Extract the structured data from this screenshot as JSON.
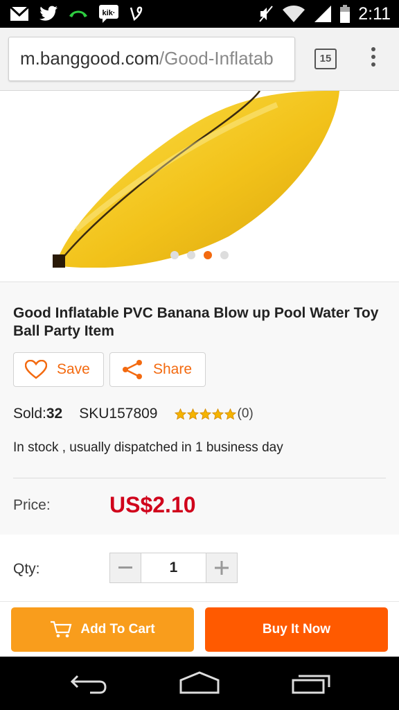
{
  "status_bar": {
    "time": "2:11",
    "left_icons": [
      "gmail-icon",
      "twitter-icon",
      "call-icon",
      "kik-icon",
      "vine-icon"
    ],
    "right_icons": [
      "mute-icon",
      "wifi-icon",
      "signal-icon",
      "battery-icon"
    ]
  },
  "browser": {
    "url_domain": "m.banggood.com",
    "url_path": "/Good-Inflatab",
    "tab_count": "15"
  },
  "product": {
    "title": "Good Inflatable PVC Banana Blow up Pool Water Toy Ball Party Item",
    "carousel": {
      "total": 4,
      "active_index": 2
    },
    "save_label": "Save",
    "share_label": "Share",
    "sold_label": "Sold:",
    "sold_count": "32",
    "sku": "SKU157809",
    "rating_stars": 5,
    "review_count": "(0)",
    "stock_text": "In stock , usually dispatched in 1 business day",
    "price_label": "Price:",
    "price_value": "US$2.10",
    "qty_label": "Qty:",
    "qty_value": "1"
  },
  "actions": {
    "add_to_cart": "Add To Cart",
    "buy_now": "Buy It Now"
  },
  "colors": {
    "accent": "#f36a10",
    "price": "#d0021b",
    "cart_button": "#f99d1c",
    "buy_button": "#ff5a00",
    "banana": "#f5c518"
  }
}
